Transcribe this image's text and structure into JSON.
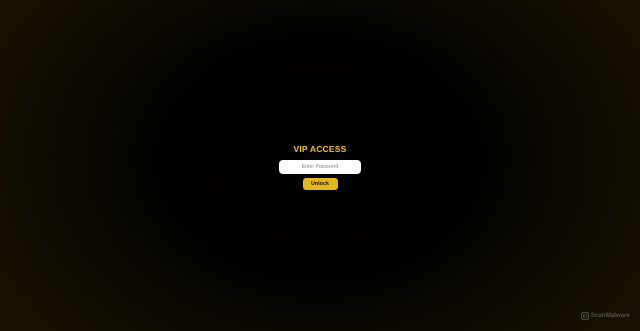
{
  "vip_gate": {
    "title": "VIP ACCESS",
    "password_placeholder": "Enter Password",
    "password_value": "",
    "unlock_label": "Unlock"
  },
  "watermark": {
    "text": "ScanMalware",
    "icon": "scanmalware-logo-icon"
  },
  "colors": {
    "accent": "#f2c31b",
    "button": "#e6b61d",
    "background": "#000000",
    "vignette": "#171103"
  }
}
